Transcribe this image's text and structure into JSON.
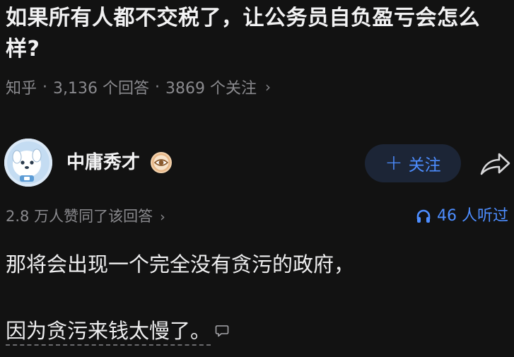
{
  "question": {
    "title": "如果所有人都不交税了，让公务员自负盈亏会怎么样?",
    "source": "知乎",
    "answer_count": "3,136 个回答",
    "follower_count": "3869 个关注",
    "separator": "·",
    "chevron": "›"
  },
  "author": {
    "name": "中庸秀才",
    "follow_label": "关注",
    "follow_plus": "+"
  },
  "stats": {
    "upvotes": "2.8 万人赞同了该回答",
    "chevron": "›",
    "listeners": "46 人听过"
  },
  "answer": {
    "line1": "那将会出现一个完全没有贪污的政府，",
    "line2": "因为贪污来钱太慢了。"
  },
  "colors": {
    "background": "#121212",
    "accent": "#4d8dff",
    "muted": "#8a8a8e",
    "follow_bg": "#1c2536"
  },
  "icons": {
    "badge": "eye-badge-icon",
    "share": "share-arrow-icon",
    "headphones": "headphones-icon",
    "comment": "comment-bubble-icon"
  }
}
